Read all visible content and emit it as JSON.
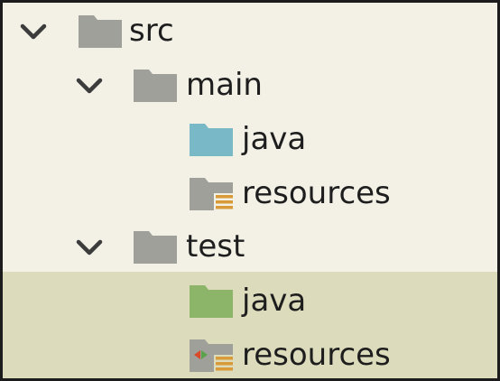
{
  "tree": {
    "nodes": [
      {
        "label": "src",
        "icon": "source-root-folder-icon",
        "expanded": true,
        "color": "#a0a09a"
      },
      {
        "label": "main",
        "icon": "folder-icon",
        "expanded": true,
        "color": "#a0a09a"
      },
      {
        "label": "java",
        "icon": "sources-folder-icon",
        "color": "#79b8c6"
      },
      {
        "label": "resources",
        "icon": "resources-folder-icon",
        "color": "#a0a09a"
      },
      {
        "label": "test",
        "icon": "folder-icon",
        "expanded": true,
        "color": "#a0a09a"
      },
      {
        "label": "java",
        "icon": "test-sources-folder-icon",
        "color": "#8cb56a"
      },
      {
        "label": "resources",
        "icon": "test-resources-folder-icon",
        "color": "#a0a09a"
      }
    ],
    "test_highlight_color": "#dcdcbc"
  }
}
